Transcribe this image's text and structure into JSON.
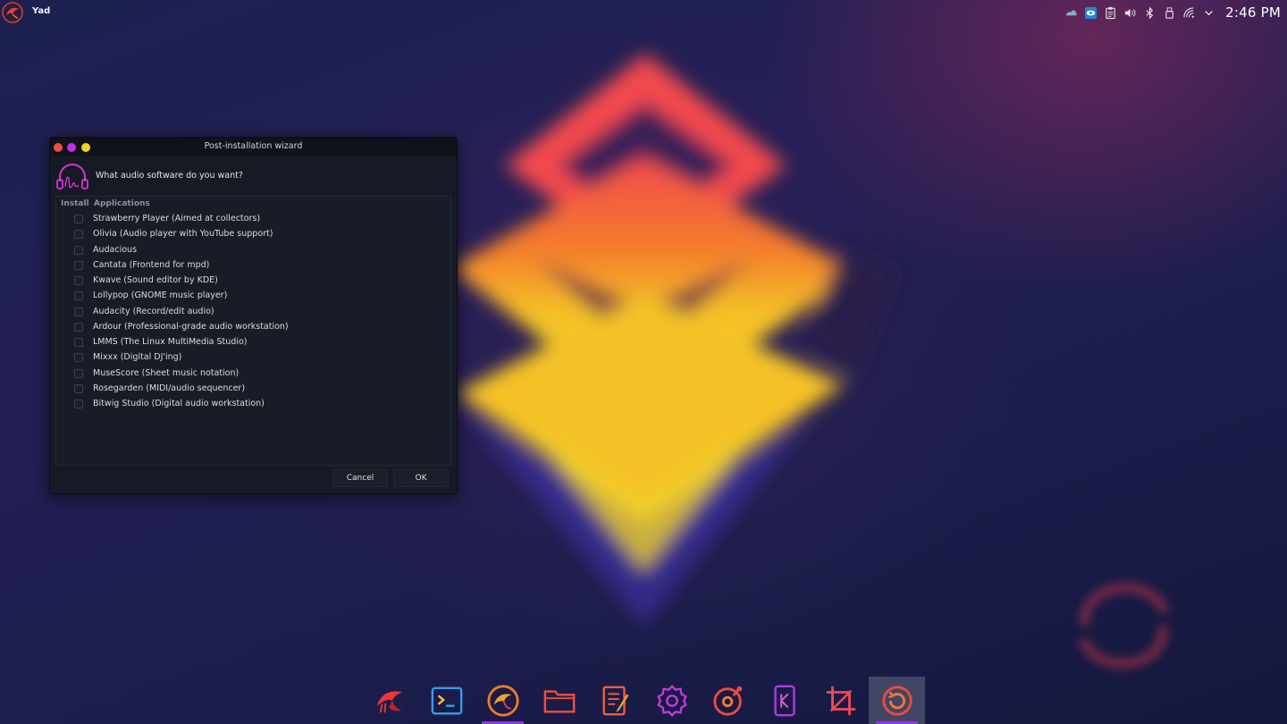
{
  "top_panel": {
    "active_app": "Yad",
    "clock": "2:46 PM",
    "tray_icons": [
      "weather-icon",
      "screenshot-icon",
      "clipboard-icon",
      "volume-icon",
      "bluetooth-icon",
      "usb-device-icon",
      "wifi-icon",
      "chevron-down-icon"
    ]
  },
  "dialog": {
    "title": "Post-installation wizard",
    "question": "What audio software do you want?",
    "columns": {
      "install": "Install",
      "applications": "Applications"
    },
    "items": [
      {
        "label": "Strawberry Player (Aimed at collectors)",
        "checked": false
      },
      {
        "label": "Olivia (Audio player with YouTube support)",
        "checked": false
      },
      {
        "label": "Audacious",
        "checked": false
      },
      {
        "label": "Cantata (Frontend for mpd)",
        "checked": false
      },
      {
        "label": "Kwave (Sound editor by KDE)",
        "checked": false
      },
      {
        "label": "Lollypop (GNOME music player)",
        "checked": false
      },
      {
        "label": "Audacity (Record/edit audio)",
        "checked": false
      },
      {
        "label": "Ardour (Professional-grade audio workstation)",
        "checked": false
      },
      {
        "label": "LMMS (The Linux MultiMedia Studio)",
        "checked": false
      },
      {
        "label": "Mixxx (Digital DJ'ing)",
        "checked": false
      },
      {
        "label": "MuseScore (Sheet music notation)",
        "checked": false
      },
      {
        "label": "Rosegarden (MIDI/audio sequencer)",
        "checked": false
      },
      {
        "label": "Bitwig Studio (Digital audio workstation)",
        "checked": false
      }
    ],
    "buttons": {
      "cancel": "Cancel",
      "ok": "OK"
    }
  },
  "dock": {
    "items": [
      "garuda-icon",
      "terminal-icon",
      "browser-icon",
      "files-icon",
      "text-editor-icon",
      "settings-icon",
      "music-player-icon",
      "kde-connect-icon",
      "crop-tool-icon",
      "timeshift-icon"
    ],
    "running": [
      "browser-icon",
      "timeshift-icon"
    ],
    "active": "timeshift-icon"
  },
  "colors": {
    "accent": "#9b2df0",
    "close": "#ef4d4b",
    "minimize": "#c030e8",
    "maximize": "#f2d324"
  }
}
